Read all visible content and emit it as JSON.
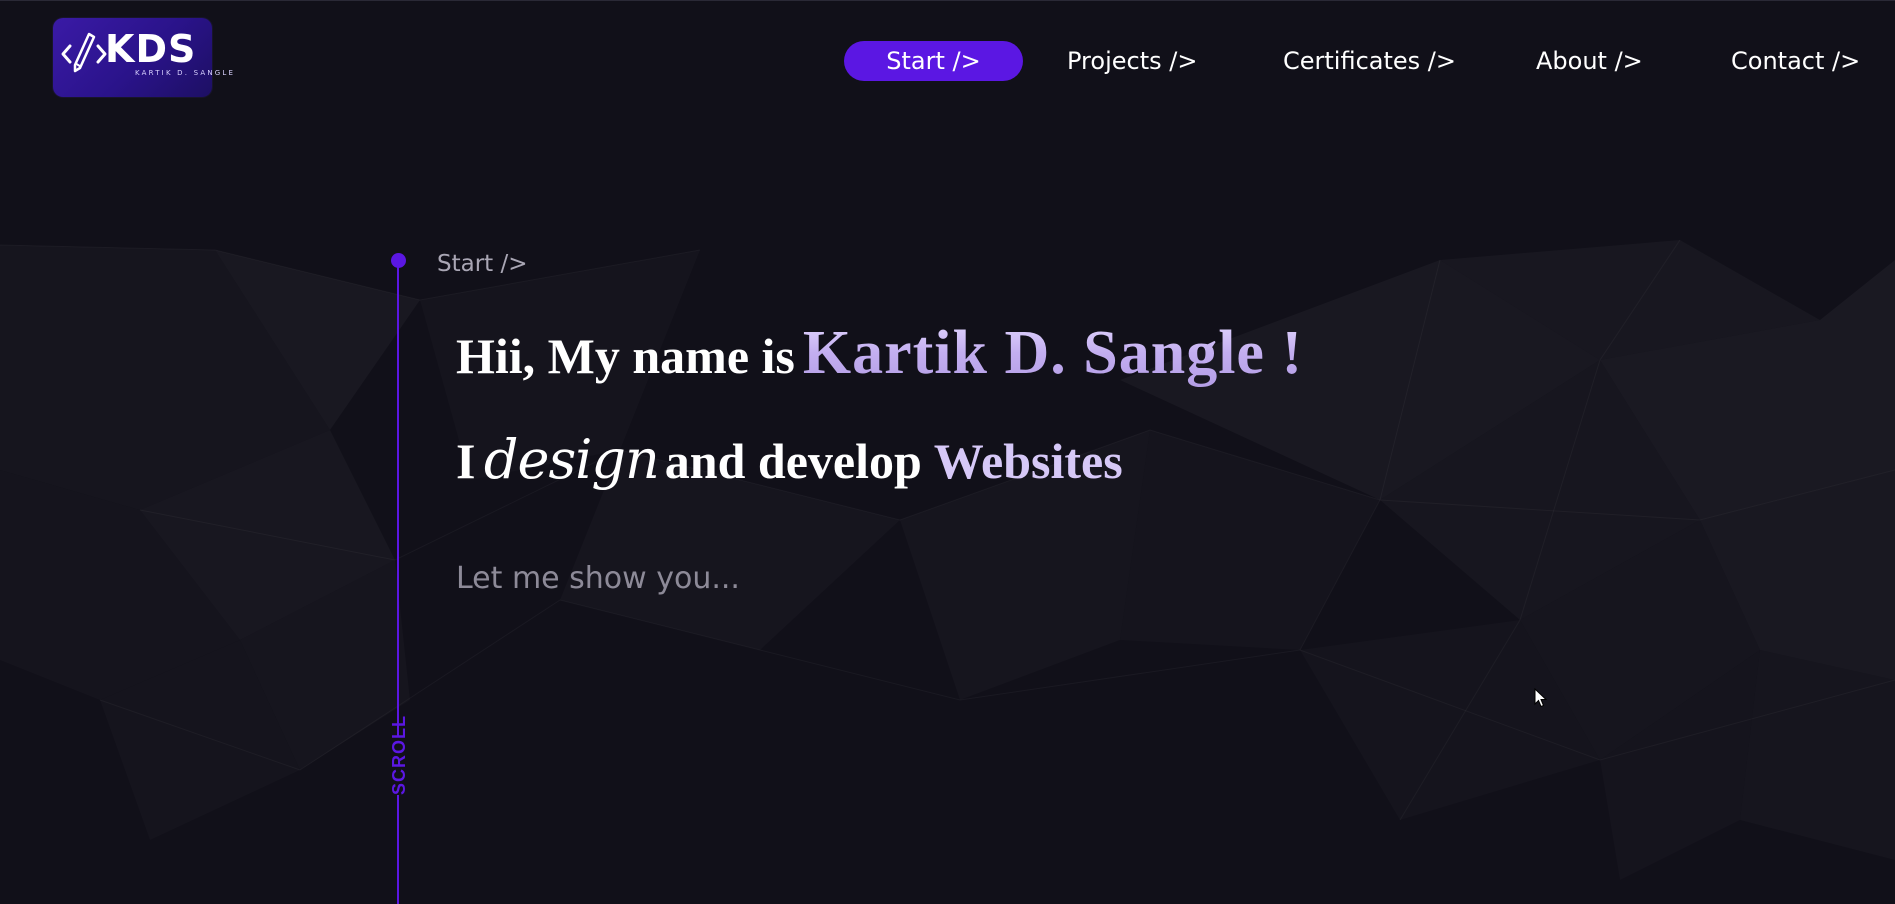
{
  "logo": {
    "icon": "code-pencil-icon",
    "text": "KDS",
    "subtitle": "KARTIK D. SANGLE"
  },
  "nav": {
    "items": [
      {
        "label": "Start />",
        "active": true
      },
      {
        "label": "Projects />",
        "active": false
      },
      {
        "label": "Certificates />",
        "active": false
      },
      {
        "label": "About />",
        "active": false
      },
      {
        "label": "Contact />",
        "active": false
      }
    ]
  },
  "section": {
    "label": "Start />",
    "scroll_label": "SCROLL"
  },
  "hero": {
    "intro": "Hii, My name is",
    "name": "Kartik D. Sangle !",
    "line2_prefix": "I",
    "line2_design": "design",
    "line2_middle": "and develop",
    "line2_rotating": "Websites",
    "tagline": "Let me show you..."
  },
  "colors": {
    "background": "#111019",
    "accent": "#5b17e3",
    "name_gradient_start": "#e3d8ff",
    "name_gradient_end": "#b49ee6",
    "muted_text": "#8d8a98"
  }
}
